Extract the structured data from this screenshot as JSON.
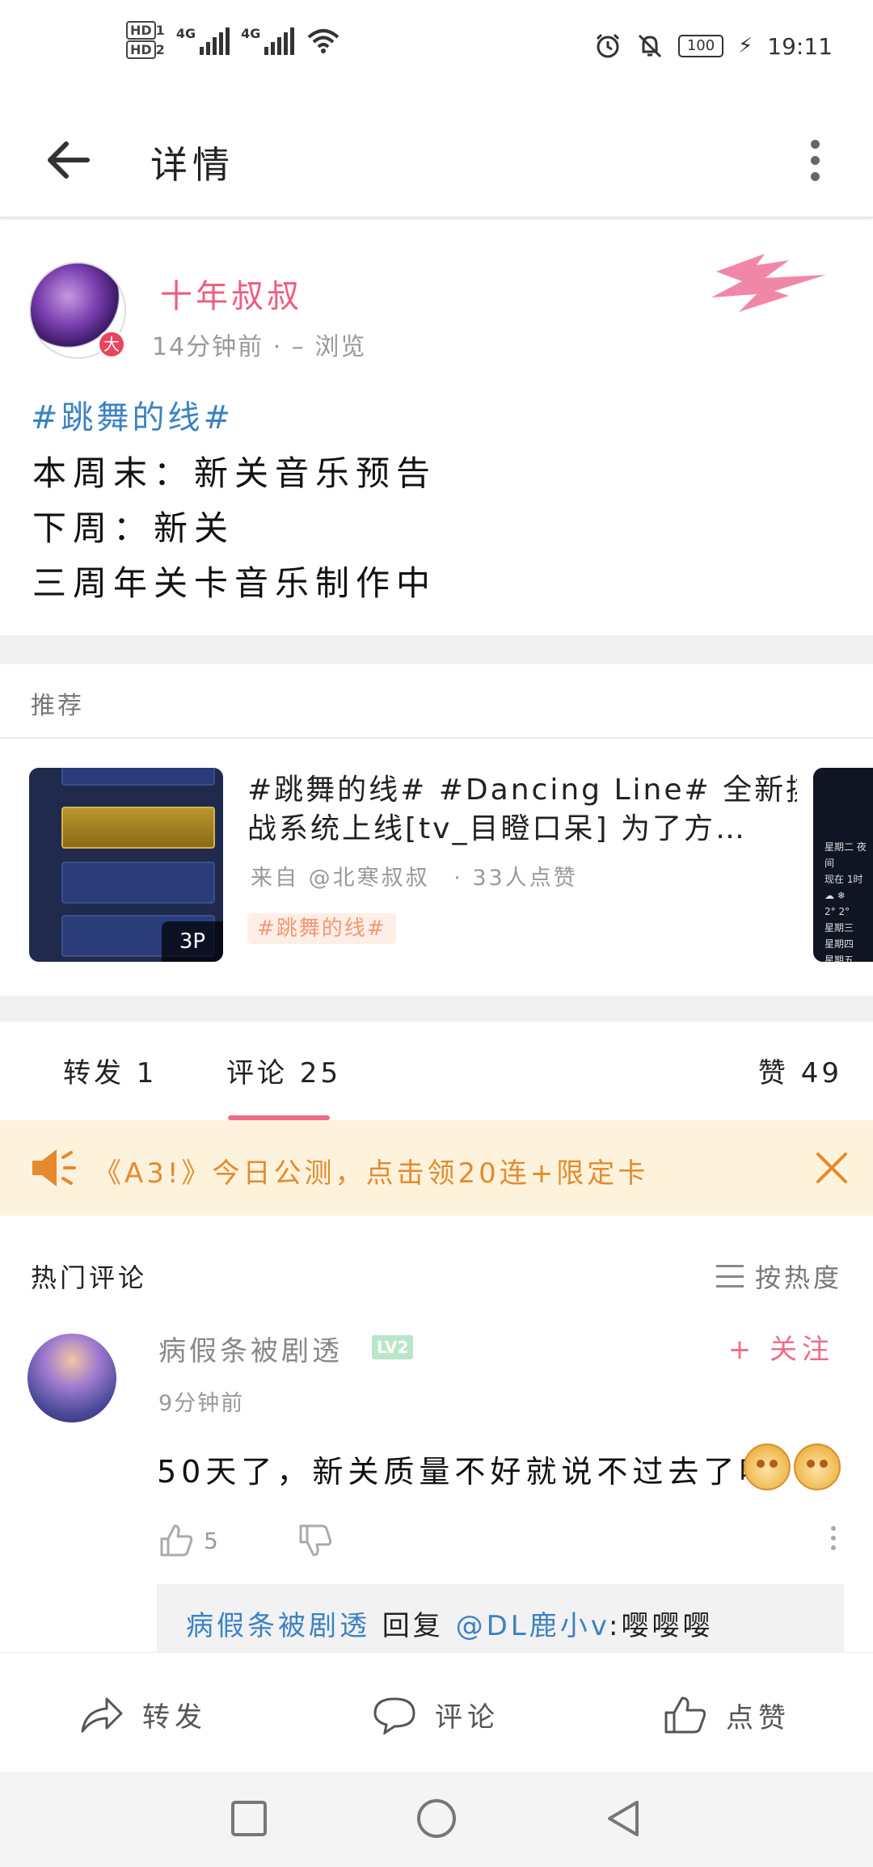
{
  "status_bar": {
    "hd1": "HD",
    "hd1_sub": "1",
    "hd2": "HD",
    "hd2_sub": "2",
    "net1": "4G",
    "net2": "4G",
    "battery": "100",
    "time": "19:11"
  },
  "app_bar": {
    "title": "详情"
  },
  "post": {
    "author": "十年叔叔",
    "verified_badge": "大",
    "time": "14分钟前",
    "views": "· – 浏览",
    "hashtag": "#跳舞的线#",
    "lines": [
      "本周末：新关音乐预告",
      "下周：新关",
      "三周年关卡音乐制作中"
    ]
  },
  "recommend": {
    "header": "推荐",
    "card": {
      "title_line1": "#跳舞的线# #Dancing Line# 全新挑",
      "title_line2": "战系统上线[tv_目瞪口呆] 为了方…",
      "source": "来自 @北寒叔叔",
      "likes": "· 33人点赞",
      "tag": "#跳舞的线#",
      "image_count": "3P"
    },
    "side_card": [
      "星期二 夜间",
      "现在  1时",
      "☁  ❄",
      "2°   2°",
      "星期三",
      "星期四",
      "星期五"
    ]
  },
  "tabs": {
    "forward": "转发 1",
    "comments": "评论 25",
    "likes": "赞 49"
  },
  "banner": {
    "text": "《A3!》今日公测，点击领20连+限定卡"
  },
  "hot_comments": {
    "title": "热门评论",
    "sort_label": "按热度"
  },
  "comment": {
    "name": "病假条被剧透",
    "level": "LV2",
    "follow": "+ 关注",
    "time": "9分钟前",
    "text": "50天了，新关质量不好就说不过去了吧",
    "likes": "5",
    "reply": {
      "name": "病假条被剧透",
      "verb": " 回复 ",
      "at": "@DL鹿小v",
      "text": ":嘤嘤嘤"
    }
  },
  "action_bar": {
    "forward": "转发",
    "comment": "评论",
    "like": "点赞"
  },
  "colors": {
    "accent_pink": "#f06b8a",
    "link_blue": "#3b82c4",
    "banner_bg": "#fdf3dc",
    "banner_text": "#e58a2e"
  },
  "icons": [
    "back-arrow-icon",
    "more-vertical-icon",
    "speaker-icon",
    "close-icon",
    "sort-lines-icon",
    "thumb-up-icon",
    "thumb-down-icon",
    "share-icon",
    "comment-icon",
    "square-nav-icon",
    "circle-nav-icon",
    "triangle-back-icon"
  ]
}
